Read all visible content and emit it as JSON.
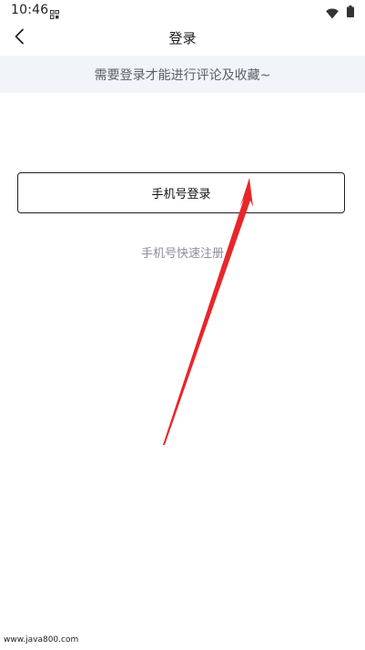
{
  "status_bar": {
    "time": "10:46",
    "left_icon": "grid-notification-icon",
    "wifi_icon": "wifi-icon",
    "battery_icon": "battery-icon"
  },
  "header": {
    "back_icon": "chevron-left-icon",
    "title": "登录"
  },
  "banner": {
    "text": "需要登录才能进行评论及收藏~"
  },
  "login": {
    "phone_login_label": "手机号登录",
    "register_label": "手机号快速注册"
  },
  "annotation": {
    "arrow_color": "#e8262a"
  },
  "watermark": {
    "text": "www.java800.com"
  }
}
